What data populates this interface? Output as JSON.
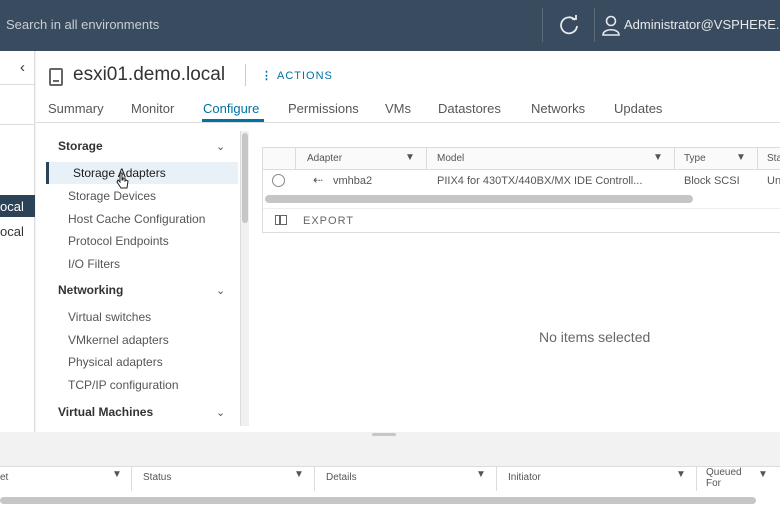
{
  "topbar": {
    "search_placeholder": "Search in all environments",
    "user": "Administrator@VSPHERE.L"
  },
  "nav": {
    "collapse_icon": "chevron-left-icon",
    "tree_selected": "ocal",
    "tree_item": "ocal"
  },
  "header": {
    "title": "esxi01.demo.local",
    "actions_label": "ACTIONS"
  },
  "tabs": [
    {
      "label": "Summary"
    },
    {
      "label": "Monitor"
    },
    {
      "label": "Configure",
      "active": true
    },
    {
      "label": "Permissions"
    },
    {
      "label": "VMs"
    },
    {
      "label": "Datastores"
    },
    {
      "label": "Networks"
    },
    {
      "label": "Updates"
    }
  ],
  "settings_menu": {
    "storage_header": "Storage",
    "storage_items": [
      "Storage Adapters",
      "Storage Devices",
      "Host Cache Configuration",
      "Protocol Endpoints",
      "I/O Filters"
    ],
    "networking_header": "Networking",
    "networking_items": [
      "Virtual switches",
      "VMkernel adapters",
      "Physical adapters",
      "TCP/IP configuration"
    ],
    "vm_header": "Virtual Machines",
    "selected": "Storage Adapters"
  },
  "adapter_grid": {
    "columns": [
      "Adapter",
      "Model",
      "Type",
      "Sta"
    ],
    "rows": [
      {
        "adapter": "vmhba2",
        "model": "PIIX4 for 430TX/440BX/MX IDE Controll...",
        "type": "Block SCSI",
        "status": "Un"
      }
    ],
    "export_label": "EXPORT"
  },
  "details": {
    "empty_message": "No items selected"
  },
  "bottom_panel": {
    "columns": [
      "et",
      "Status",
      "Details",
      "Initiator",
      "Queued For"
    ]
  }
}
